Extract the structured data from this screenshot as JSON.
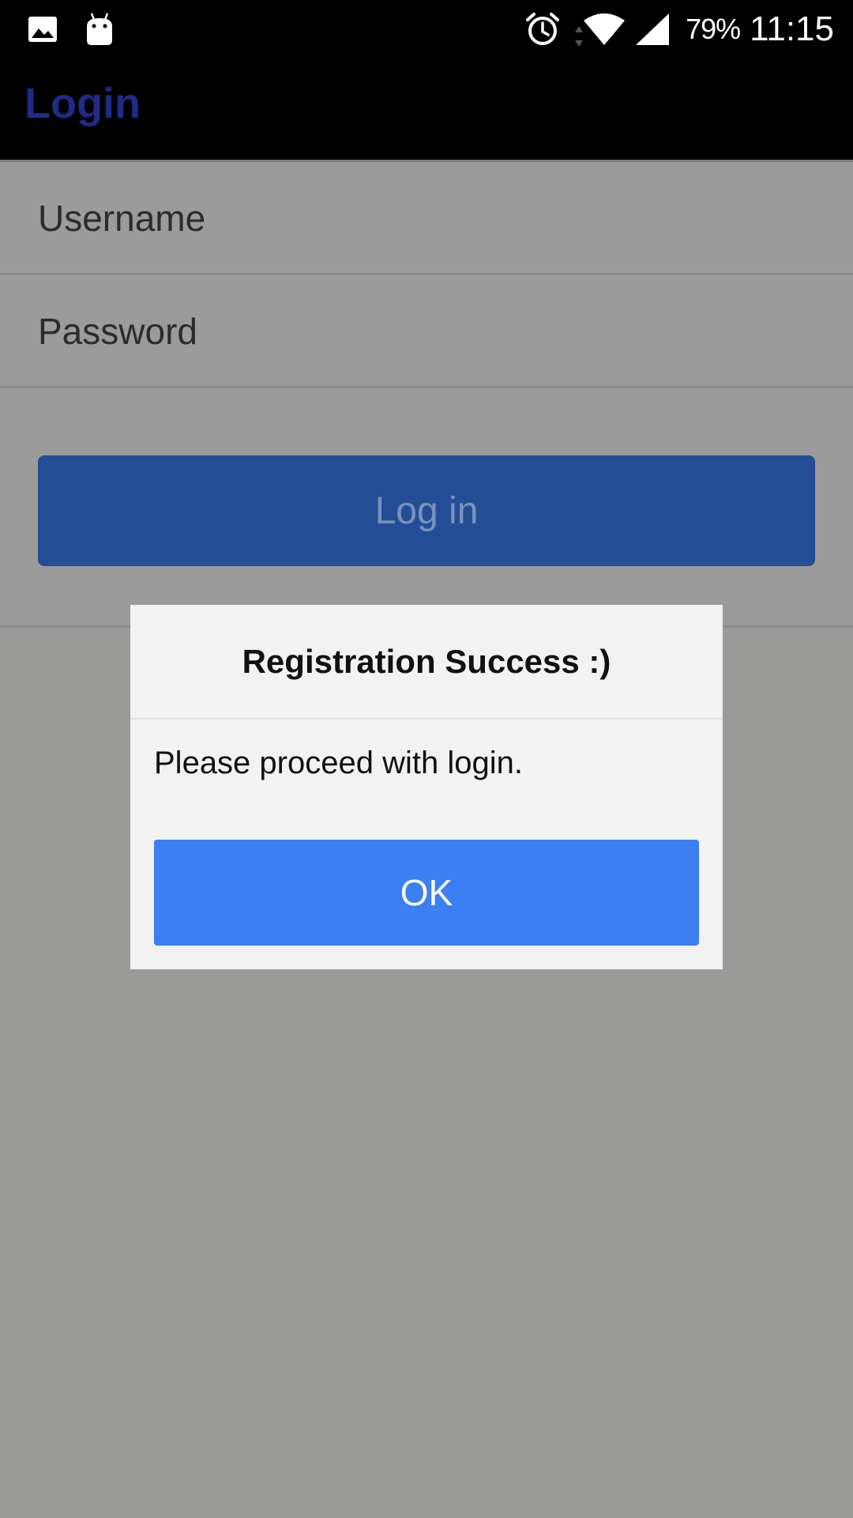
{
  "status_bar": {
    "battery": "79%",
    "time": "11:15",
    "left_icons": [
      "gallery-icon",
      "android-icon"
    ],
    "right_icons": [
      "alarm-icon",
      "data-arrows-icon",
      "wifi-icon",
      "cell-signal-icon"
    ]
  },
  "header": {
    "title": "Login",
    "title_color": "#1e2c86"
  },
  "form": {
    "username_placeholder": "Username",
    "password_placeholder": "Password",
    "login_label": "Log in"
  },
  "dialog": {
    "title": "Registration Success :)",
    "message": "Please proceed with login.",
    "ok_label": "OK",
    "ok_color": "#3b7ff3"
  }
}
